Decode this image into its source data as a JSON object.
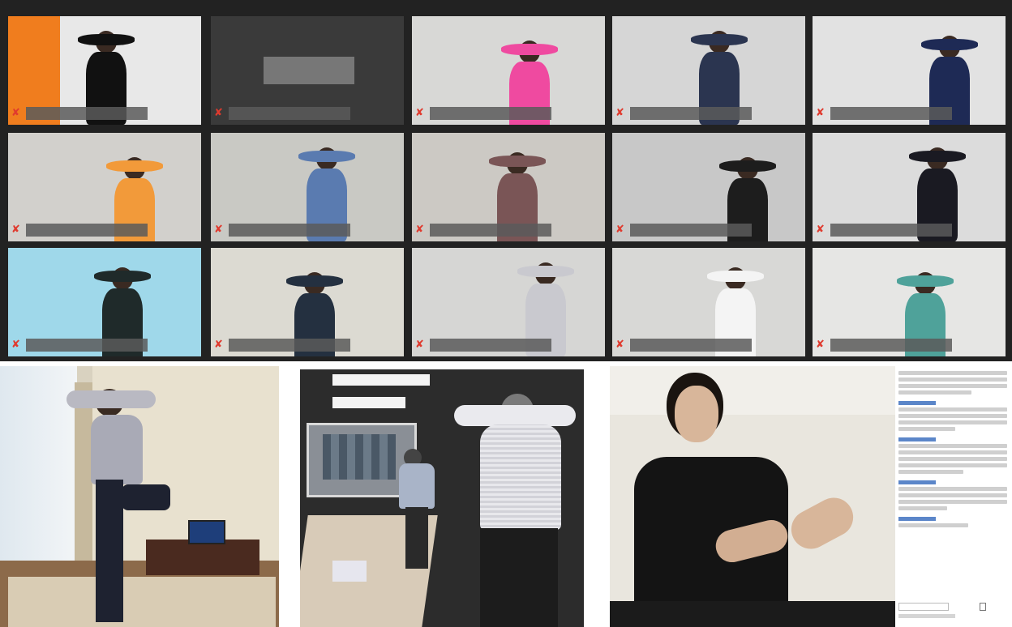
{
  "grid": {
    "active_tile": 0,
    "tiles": [
      {
        "bg": "#e8e8e8",
        "accent": "#f07d1e",
        "shirt": "#111111",
        "video": true
      },
      {
        "bg": "#3a3a3a",
        "video": false
      },
      {
        "bg": "#d8d8d6",
        "shirt": "#ef4aa0",
        "video": true
      },
      {
        "bg": "#d6d6d6",
        "shirt": "#2b3550",
        "video": true
      },
      {
        "bg": "#e2e2e2",
        "shirt": "#1e2a55",
        "video": true
      },
      {
        "bg": "#d2d0cc",
        "shirt": "#f29a3a",
        "video": true
      },
      {
        "bg": "#c9c9c4",
        "shirt": "#5a7bb0",
        "video": true
      },
      {
        "bg": "#ccc9c4",
        "shirt": "#7a5556",
        "video": true
      },
      {
        "bg": "#c8c8c8",
        "shirt": "#1d1d1d",
        "video": true
      },
      {
        "bg": "#dcdcdc",
        "shirt": "#1a1a22",
        "video": true
      },
      {
        "bg": "#9fd8ea",
        "shirt": "#1f2a2a",
        "video": true
      },
      {
        "bg": "#dcdad2",
        "shirt": "#243040",
        "video": true
      },
      {
        "bg": "#d6d6d4",
        "shirt": "#c9c9cf",
        "video": true
      },
      {
        "bg": "#d8d8d6",
        "shirt": "#f4f4f4",
        "video": true
      },
      {
        "bg": "#e6e6e4",
        "shirt": "#4fa29a",
        "video": true
      }
    ]
  },
  "colors": {
    "mute_icon": "#e03a2e",
    "active_border": "#d9f20f"
  },
  "icons": {
    "mute": "mic-muted-icon"
  }
}
